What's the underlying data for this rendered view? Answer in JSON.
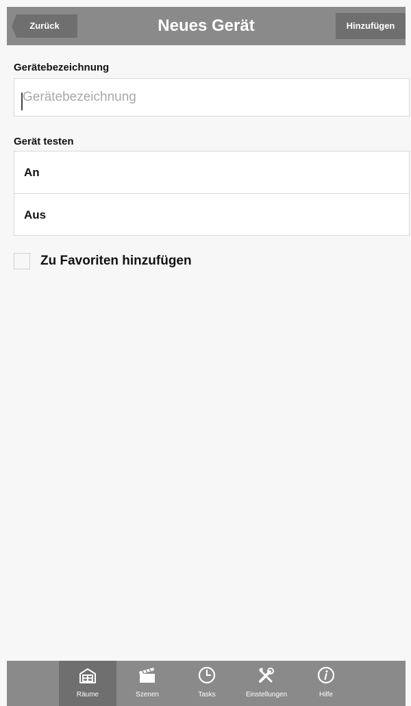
{
  "header": {
    "back_label": "Zurück",
    "title": "Neues Gerät",
    "add_label": "Hinzufügen"
  },
  "form": {
    "name_label": "Gerätebezeichnung",
    "name_placeholder": "Gerätebezeichnung",
    "name_value": "",
    "test_label": "Gerät testen",
    "test_options": [
      "An",
      "Aus"
    ],
    "favorite_label": "Zu Favoriten hinzufügen",
    "favorite_checked": false
  },
  "tabs": [
    {
      "label": "Räume",
      "icon": "rooms-icon",
      "active": true
    },
    {
      "label": "Szenen",
      "icon": "clapperboard-icon",
      "active": false
    },
    {
      "label": "Tasks",
      "icon": "clock-icon",
      "active": false
    },
    {
      "label": "Einstellungen",
      "icon": "tools-icon",
      "active": false
    },
    {
      "label": "Hilfe",
      "icon": "info-icon",
      "active": false
    }
  ],
  "colors": {
    "bar": "#8a8a8a",
    "bar_button": "#6f6f6f",
    "background": "#f7f7f7"
  }
}
